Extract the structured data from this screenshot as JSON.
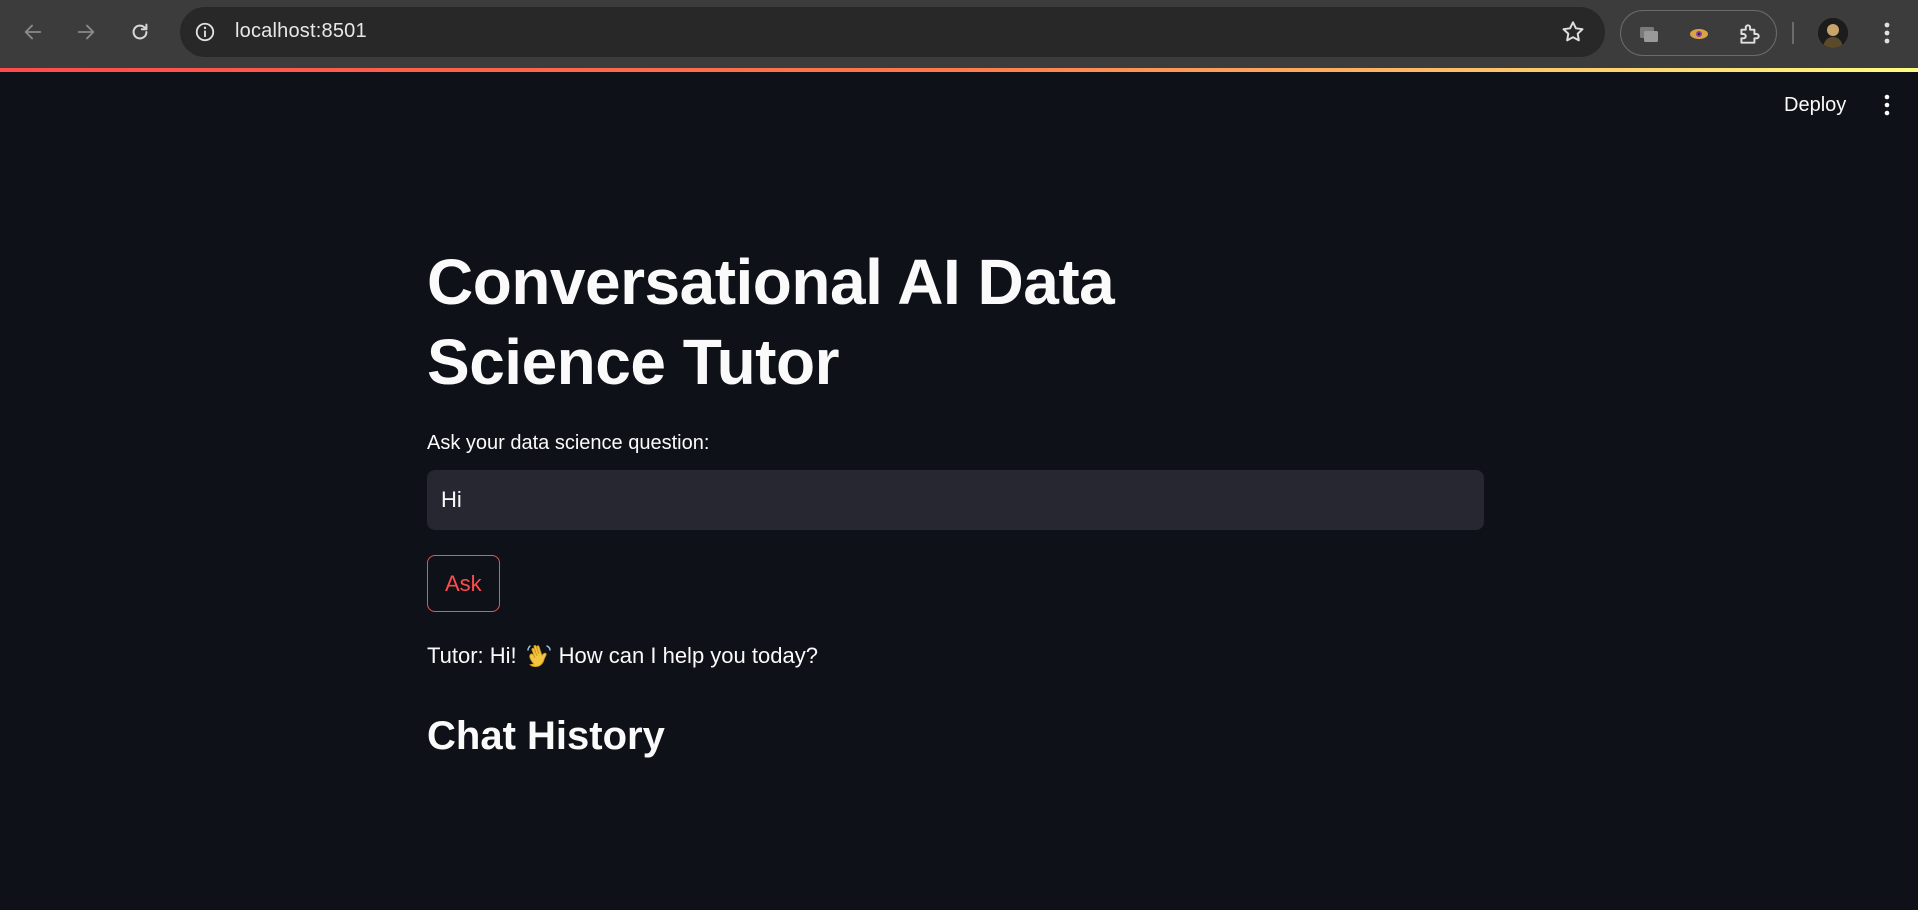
{
  "browser": {
    "url": "localhost:8501"
  },
  "header": {
    "deploy_label": "Deploy"
  },
  "main": {
    "title": "Conversational AI Data Science Tutor",
    "input_label": "Ask your data science question:",
    "input_value": "Hi",
    "ask_label": "Ask",
    "response_prefix": "Tutor: Hi!",
    "response_suffix": "How can I help you today?",
    "chat_history_heading": "Chat History"
  },
  "colors": {
    "background": "#0e1117",
    "input_bg": "#262730",
    "accent": "#ff4b4b"
  }
}
